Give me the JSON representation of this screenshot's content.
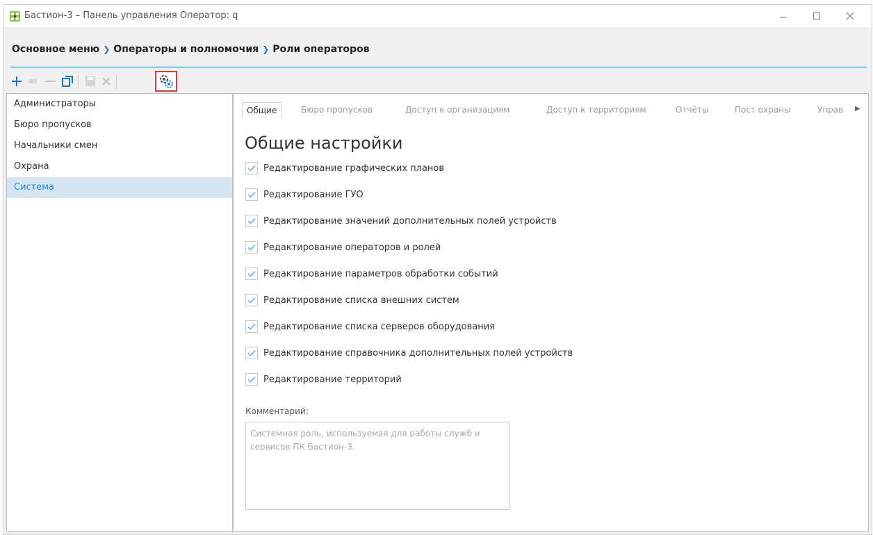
{
  "window": {
    "title": "Бастион-3 – Панель управления Оператор: q",
    "icon": "app-logo-icon"
  },
  "breadcrumb": {
    "items": [
      "Основное меню",
      "Операторы и полномочия",
      "Роли операторов"
    ]
  },
  "toolbar": {
    "buttons": [
      "add-icon",
      "edit-icon",
      "remove-icon",
      "copy-icon",
      "save-icon",
      "cancel-icon",
      "role-settings-icon"
    ],
    "active": "role-settings-icon",
    "accent": "#1e78c8",
    "highlight": "#e53935"
  },
  "roles": {
    "items": [
      "Администраторы",
      "Бюро пропусков",
      "Начальники смен",
      "Охрана",
      "Система"
    ],
    "selected": "Система",
    "selected_bg": "#d6e5f2",
    "selected_color": "#2e86d8"
  },
  "tabs": {
    "items": [
      "Общие",
      "Бюро пропусков",
      "Доступ к организациям",
      "Доступ к территориям",
      "Отчёты",
      "Пост охраны",
      "Управ"
    ],
    "active": "Общие"
  },
  "general": {
    "title": "Общие настройки",
    "settings": [
      {
        "label": "Редактирование графических планов",
        "checked": true
      },
      {
        "label": "Редактирование ГУО",
        "checked": true
      },
      {
        "label": "Редактирование значений дополнительных полей устройств",
        "checked": true
      },
      {
        "label": "Редактирование операторов и ролей",
        "checked": true
      },
      {
        "label": "Редактирование параметров обработки событий",
        "checked": true
      },
      {
        "label": "Редактирование списка внешних систем",
        "checked": true
      },
      {
        "label": "Редактирование списка серверов оборудования",
        "checked": true
      },
      {
        "label": "Редактирование справочника дополнительных полей устройств",
        "checked": true
      },
      {
        "label": "Редактирование территорий",
        "checked": true
      }
    ],
    "comment_label": "Комментарий:",
    "comment_text": "Системная роль, используемая для работы служб и сервисов ПК Бастион-3."
  }
}
